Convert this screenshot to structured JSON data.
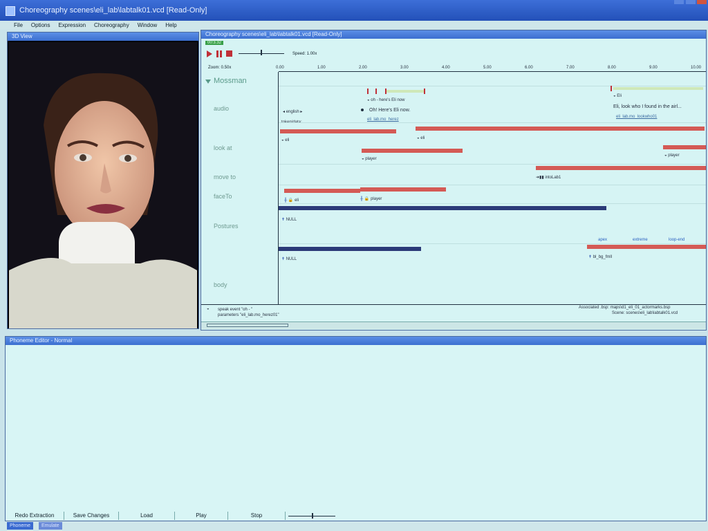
{
  "window": {
    "title": "Choreography  scenes\\eli_lab\\labtalk01.vcd [Read-Only]"
  },
  "menu": [
    "File",
    "Options",
    "Expression",
    "Choreography",
    "Window",
    "Help"
  ],
  "view3d": {
    "title": "3D View"
  },
  "choreo": {
    "title": "Choreography  scenes\\eli_lab\\labtalk01.vcd [Read-Only]",
    "time_badge": "00:3.32",
    "speed_label": "Speed: 1.00x",
    "zoom_label": "Zoom: 0.50x",
    "actor": "Mossman",
    "ticks": [
      "0.00",
      "1.00",
      "2.00",
      "3.00",
      "4.00",
      "5.00",
      "6.00",
      "7.00",
      "8.00",
      "9.00",
      "10.00"
    ],
    "rows": [
      "audio",
      "look at",
      "move to",
      "faceTo",
      "Postures",
      "body"
    ],
    "audio": {
      "language": "english",
      "token_label": "token/data:",
      "evt1_words": "oh - here's Eli now",
      "evt1_text": "Oh! Here's Eli now.",
      "evt1_file": "eli_lab.mo_herez",
      "evt2_word": "Eli",
      "evt2_text": "Eli, look who I found in the airl...",
      "evt2_file": "eli_lab.mo_lookwho01"
    },
    "lookat": {
      "target1": "eli",
      "target2": "eli",
      "target3": "player",
      "target4": "player"
    },
    "moveto": {
      "target": "intoLab1"
    },
    "faceto": {
      "target1": "eli",
      "target2": "player"
    },
    "postures": {
      "null1": "NULL",
      "null2": "NULL",
      "marker_apex": "apex",
      "marker_extreme": "extreme",
      "marker_loop": "loop-end",
      "gesture": "bl_bg_fmll"
    },
    "status": {
      "event": "speak event \"oh - \"",
      "parameters": "parameters \"eli_lab.mo_herez01\"",
      "associated": "Associated .bsp:  maps\\d1_eli_01_actormarks.bsp",
      "scene": "Scene:  scenes\\eli_lab\\labtalk01.vcd"
    }
  },
  "phoneme": {
    "title": "Phoneme Editor - Normal",
    "buttons": [
      "Redo Extraction",
      "Save Changes",
      "Load",
      "Play",
      "Stop"
    ]
  },
  "taskbar": [
    "Phoneme",
    "Emulate"
  ],
  "colors": {
    "accent": "#3c6fd0",
    "event_red": "#d45a55",
    "event_navy": "#2b3a78",
    "panel_bg": "#d6f4f4"
  }
}
